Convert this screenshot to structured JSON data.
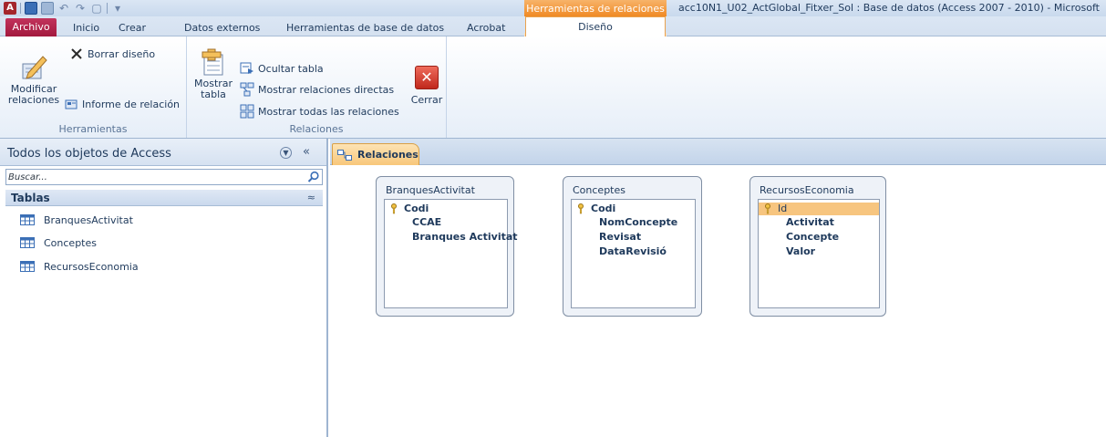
{
  "titlebar": {
    "context_tab_header": "Herramientas de relaciones",
    "window_title": "acc10N1_U02_ActGlobal_Fitxer_Sol : Base de datos (Access 2007 - 2010) - Microsoft",
    "logo_letter": "A"
  },
  "tabs": {
    "archivo": "Archivo",
    "inicio": "Inicio",
    "crear": "Crear",
    "datos_externos": "Datos externos",
    "herramientas_bd": "Herramientas de base de datos",
    "acrobat": "Acrobat",
    "diseno": "Diseño"
  },
  "ribbon": {
    "herramientas": {
      "label": "Herramientas",
      "modificar_line1": "Modificar",
      "modificar_line2": "relaciones",
      "borrar_diseno": "Borrar diseño",
      "informe_relacion": "Informe de relación"
    },
    "relaciones": {
      "label": "Relaciones",
      "mostrar_line1": "Mostrar",
      "mostrar_line2": "tabla",
      "ocultar_tabla": "Ocultar tabla",
      "mostrar_directas": "Mostrar relaciones directas",
      "mostrar_todas": "Mostrar todas las relaciones",
      "cerrar": "Cerrar"
    }
  },
  "nav": {
    "title": "Todos los objetos de Access",
    "search_placeholder": "Buscar...",
    "group_label": "Tablas",
    "items": [
      {
        "label": "BranquesActivitat"
      },
      {
        "label": "Conceptes"
      },
      {
        "label": "RecursosEconomia"
      }
    ]
  },
  "document": {
    "tab_label": "Relaciones",
    "tables": [
      {
        "name": "BranquesActivitat",
        "fields": [
          {
            "label": "Codi",
            "key": true
          },
          {
            "label": "CCAE"
          },
          {
            "label": "Branques Activitat"
          }
        ]
      },
      {
        "name": "Conceptes",
        "fields": [
          {
            "label": "Codi",
            "key": true
          },
          {
            "label": "NomConcepte"
          },
          {
            "label": "Revisat"
          },
          {
            "label": "DataRevisió"
          }
        ]
      },
      {
        "name": "RecursosEconomia",
        "fields": [
          {
            "label": "Id",
            "key": true,
            "selected": true
          },
          {
            "label": "Activitat"
          },
          {
            "label": "Concepte"
          },
          {
            "label": "Valor"
          }
        ]
      }
    ]
  },
  "colors": {
    "archivo_tab": "#a3193e",
    "context_orange": "#f08a24",
    "selected_field": "#f7c57f",
    "doc_tab": "#f8c77a"
  }
}
